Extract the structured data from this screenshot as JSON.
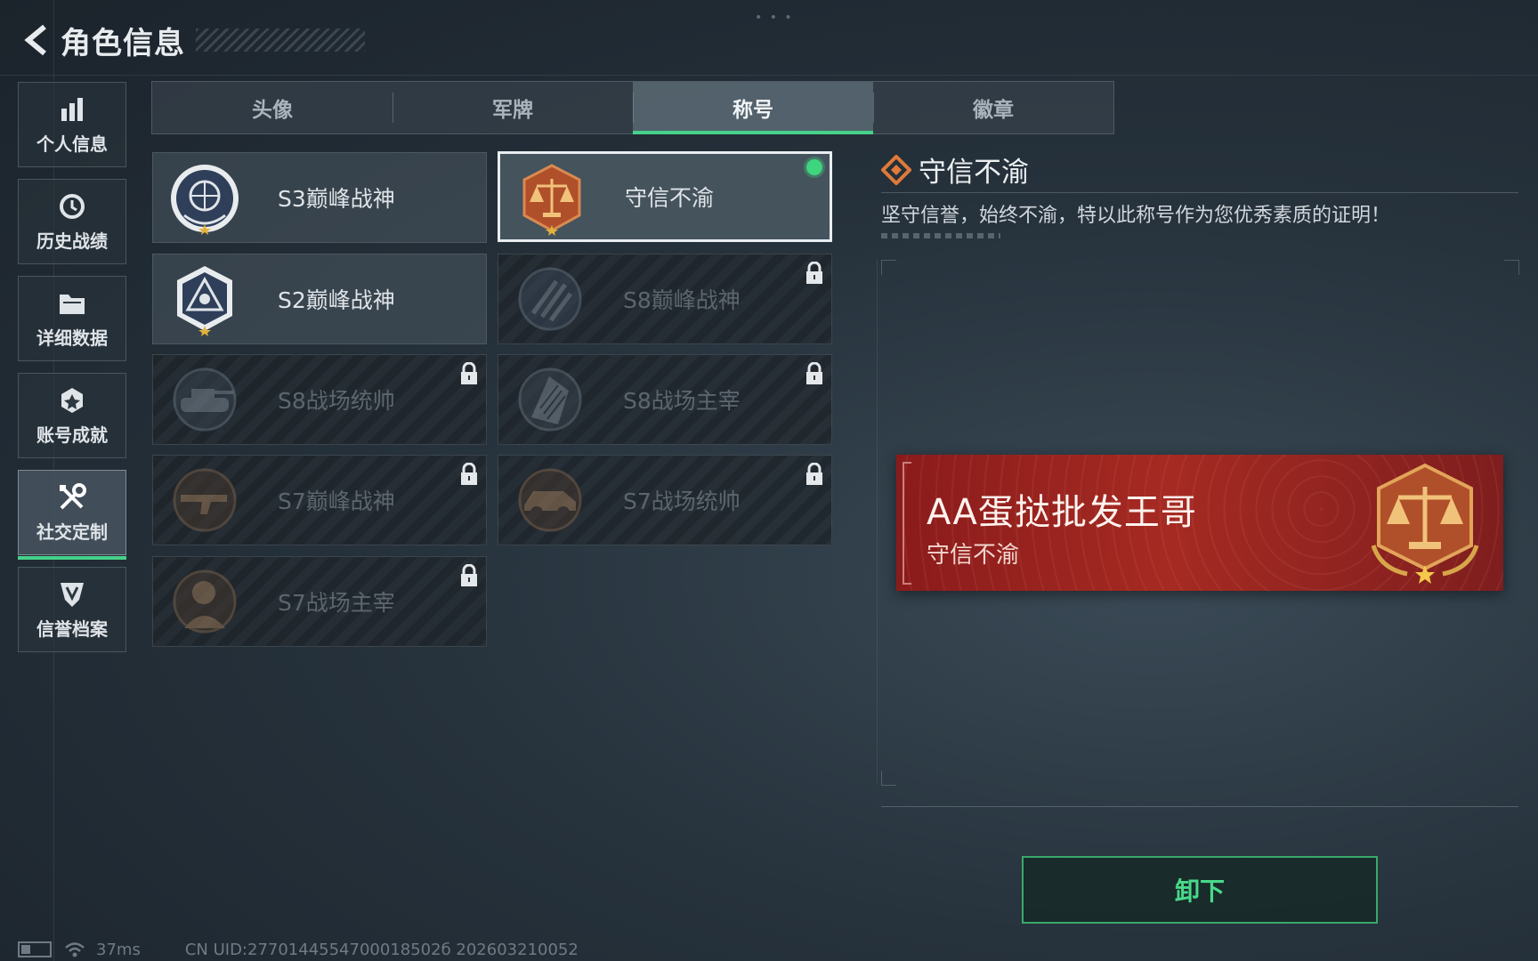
{
  "header": {
    "title": "角色信息"
  },
  "sidebar": {
    "items": [
      {
        "label": "个人信息",
        "icon": "bar-chart-icon"
      },
      {
        "label": "历史战绩",
        "icon": "history-icon"
      },
      {
        "label": "详细数据",
        "icon": "folder-icon"
      },
      {
        "label": "账号成就",
        "icon": "medal-icon"
      },
      {
        "label": "社交定制",
        "icon": "tools-icon",
        "active": true
      },
      {
        "label": "信誉档案",
        "icon": "shield-icon"
      }
    ]
  },
  "tabs": [
    {
      "label": "头像"
    },
    {
      "label": "军牌"
    },
    {
      "label": "称号",
      "active": true
    },
    {
      "label": "徽章"
    }
  ],
  "titles": [
    {
      "name": "S3巅峰战神",
      "state": "unlocked"
    },
    {
      "name": "守信不渝",
      "state": "selected"
    },
    {
      "name": "S2巅峰战神",
      "state": "unlocked"
    },
    {
      "name": "S8巅峰战神",
      "state": "locked"
    },
    {
      "name": "S8战场统帅",
      "state": "locked"
    },
    {
      "name": "S8战场主宰",
      "state": "locked"
    },
    {
      "name": "S7巅峰战神",
      "state": "locked"
    },
    {
      "name": "S7战场统帅",
      "state": "locked"
    },
    {
      "name": "S7战场主宰",
      "state": "locked"
    }
  ],
  "detail": {
    "title": "守信不渝",
    "description": "坚守信誉，始终不渝，特以此称号作为您优秀素质的证明！"
  },
  "banner": {
    "player_name": "AA蛋挞批发王哥",
    "title": "守信不渝"
  },
  "actions": {
    "unequip_label": "卸下"
  },
  "status": {
    "ping": "37ms",
    "uid": "CN UID:2770144554700018502б 202603210052"
  },
  "colors": {
    "accent_green": "#46d18a",
    "banner_red": "#a52a22",
    "emblem_bronze": "#b0502a"
  }
}
